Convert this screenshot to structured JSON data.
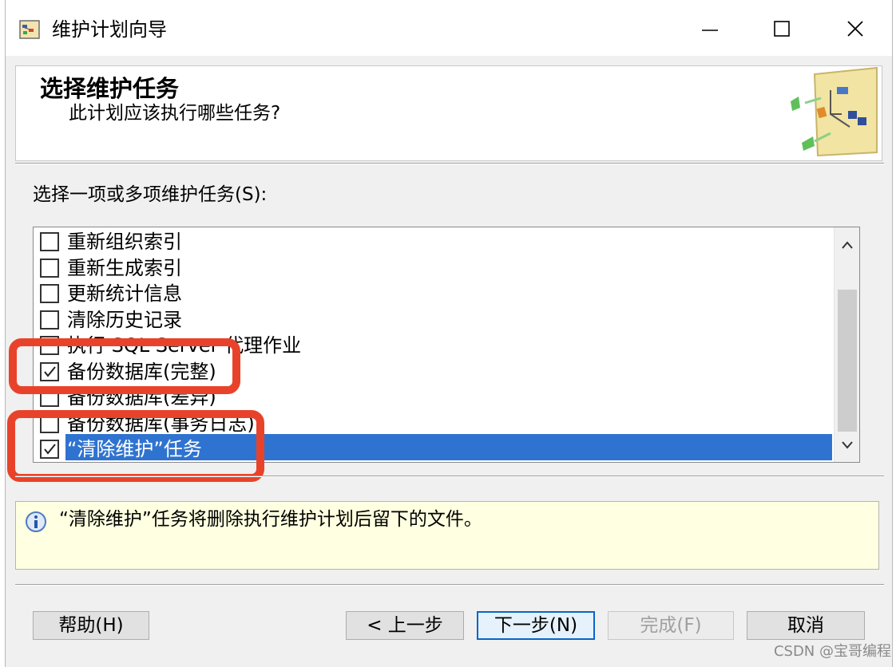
{
  "window": {
    "title": "维护计划向导"
  },
  "header": {
    "title": "选择维护任务",
    "subtitle": "此计划应该执行哪些任务?"
  },
  "list": {
    "label": "选择一项或多项维护任务(S):",
    "items": [
      {
        "label": "重新组织索引",
        "checked": false
      },
      {
        "label": "重新生成索引",
        "checked": false
      },
      {
        "label": "更新统计信息",
        "checked": false
      },
      {
        "label": "清除历史记录",
        "checked": false
      },
      {
        "label": "执行 SQL Server 代理作业",
        "checked": false
      },
      {
        "label": "备份数据库(完整)",
        "checked": true
      },
      {
        "label": "备份数据库(差异)",
        "checked": false
      },
      {
        "label": "备份数据库(事务日志)",
        "checked": false
      },
      {
        "label": "“清除维护”任务",
        "checked": true,
        "selected": true
      }
    ]
  },
  "info": {
    "text": "“清除维护”任务将删除执行维护计划后留下的文件。"
  },
  "buttons": {
    "help": "帮助(H)",
    "back": "< 上一步",
    "next": "下一步(N)",
    "finish": "完成(F)",
    "cancel": "取消"
  },
  "watermark": "CSDN @宝哥编程",
  "colors": {
    "selection": "#2f73d0",
    "highlight": "#e8432a",
    "info_bg": "#ffffe1"
  }
}
